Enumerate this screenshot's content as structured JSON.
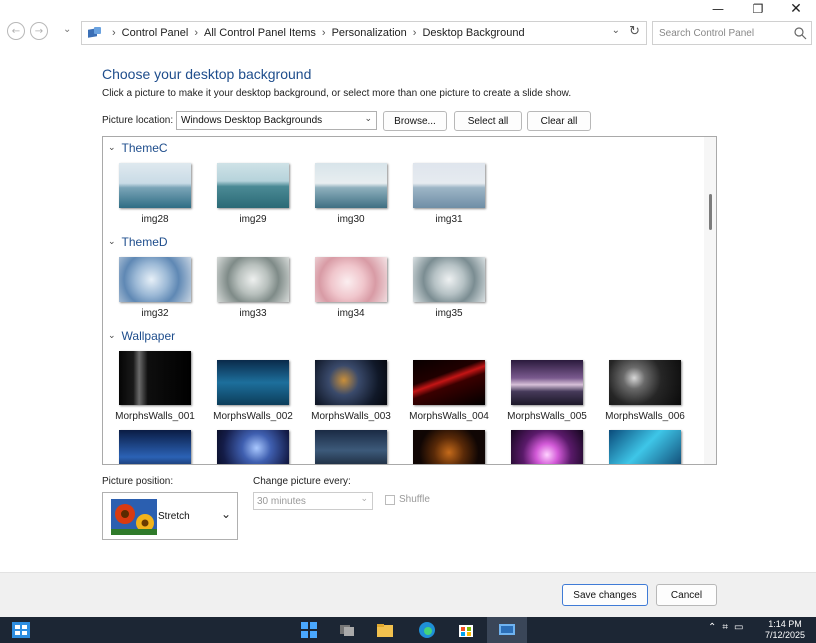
{
  "window": {
    "minimize_icon": "minimize-icon",
    "maximize_icon": "restore-icon",
    "close_icon": "close-icon"
  },
  "address": {
    "crumbs": [
      "Control Panel",
      "All Control Panel Items",
      "Personalization",
      "Desktop Background"
    ],
    "search_placeholder": "Search Control Panel"
  },
  "page": {
    "title": "Choose your desktop background",
    "subtitle": "Click a picture to make it your desktop background, or select more than one picture to create a slide show.",
    "location_label": "Picture location:",
    "location_value": "Windows Desktop Backgrounds",
    "browse_label": "Browse...",
    "select_all_label": "Select all",
    "clear_all_label": "Clear all"
  },
  "groups": [
    {
      "name": "ThemeC",
      "items": [
        "img28",
        "img29",
        "img30",
        "img31"
      ]
    },
    {
      "name": "ThemeD",
      "items": [
        "img32",
        "img33",
        "img34",
        "img35"
      ]
    },
    {
      "name": "Wallpaper",
      "items": [
        "MorphsWalls_001",
        "MorphsWalls_002",
        "MorphsWalls_003",
        "MorphsWalls_004",
        "MorphsWalls_005",
        "MorphsWalls_006"
      ]
    }
  ],
  "position": {
    "label": "Picture position:",
    "value": "Stretch"
  },
  "slideshow": {
    "label": "Change picture every:",
    "interval": "30 minutes",
    "shuffle_label": "Shuffle"
  },
  "footer": {
    "save_label": "Save changes",
    "cancel_label": "Cancel"
  },
  "taskbar": {
    "time": "1:14 PM",
    "date": "7/12/2025"
  }
}
